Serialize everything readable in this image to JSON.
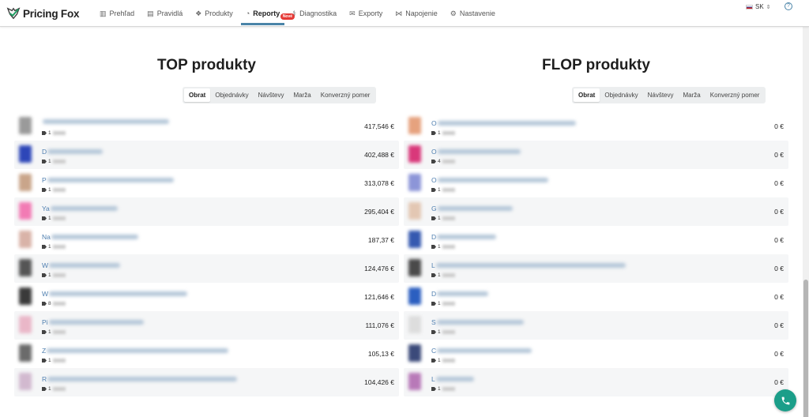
{
  "app": {
    "logo_text": "Pricing Fox"
  },
  "nav": [
    {
      "label": "Prehľad",
      "icon": "bar-chart-icon",
      "active": false
    },
    {
      "label": "Pravidlá",
      "icon": "list-icon",
      "active": false
    },
    {
      "label": "Produkty",
      "icon": "boxes-icon",
      "active": false
    },
    {
      "label": "Reporty",
      "icon": "pie-chart-icon",
      "active": true,
      "badge": "Nové"
    },
    {
      "label": "Diagnostika",
      "icon": "stethoscope-icon",
      "active": false
    },
    {
      "label": "Exporty",
      "icon": "inbox-icon",
      "active": false
    },
    {
      "label": "Napojenie",
      "icon": "share-icon",
      "active": false
    },
    {
      "label": "Nastavenie",
      "icon": "gear-icon",
      "active": false
    }
  ],
  "language": "SK",
  "help": "?",
  "accent_color": "#4a84a8",
  "top": {
    "title": "TOP produkty",
    "tabs": [
      "Obrat",
      "Objednávky",
      "Návštevy",
      "Marža",
      "Konverzný pomer"
    ],
    "active_tab": "Obrat",
    "rows": [
      {
        "name_start": "",
        "count": "1",
        "value": "417,546 €",
        "color": "#9a9a9a"
      },
      {
        "name_start": "D",
        "count": "1",
        "value": "402,488 €",
        "color": "#2d46b8"
      },
      {
        "name_start": "P",
        "count": "1",
        "value": "313,078 €",
        "color": "#c9a58a"
      },
      {
        "name_start": "Ya",
        "count": "1",
        "value": "295,404 €",
        "color": "#f27bb4"
      },
      {
        "name_start": "Na",
        "count": "1",
        "value": "187,37 €",
        "color": "#d9b3a8"
      },
      {
        "name_start": "W",
        "count": "1",
        "value": "124,476 €",
        "color": "#555555"
      },
      {
        "name_start": "W",
        "count": "8",
        "value": "121,646 €",
        "color": "#3a3a3a"
      },
      {
        "name_start": "Pi",
        "count": "1",
        "value": "111,076 €",
        "color": "#eab7c8"
      },
      {
        "name_start": "Z",
        "count": "1",
        "value": "105,13 €",
        "color": "#6b6b6b"
      },
      {
        "name_start": "R",
        "count": "1",
        "value": "104,426 €",
        "color": "#d2b9cf"
      }
    ]
  },
  "flop": {
    "title": "FLOP produkty",
    "tabs": [
      "Obrat",
      "Objednávky",
      "Návštevy",
      "Marža",
      "Konverzný pomer"
    ],
    "active_tab": "Obrat",
    "rows": [
      {
        "name_start": "O",
        "count": "1",
        "value": "0 €",
        "color": "#e6a27e"
      },
      {
        "name_start": "O",
        "count": "4",
        "value": "0 €",
        "color": "#d9387a"
      },
      {
        "name_start": "O",
        "count": "1",
        "value": "0 €",
        "color": "#8c95d8"
      },
      {
        "name_start": "G",
        "count": "1",
        "value": "0 €",
        "color": "#e3c7b3"
      },
      {
        "name_start": "D",
        "count": "1",
        "value": "0 €",
        "color": "#3559b0"
      },
      {
        "name_start": "L",
        "count": "1",
        "value": "0 €",
        "color": "#4a4a4a"
      },
      {
        "name_start": "D",
        "count": "1",
        "value": "0 €",
        "color": "#2b5fc0"
      },
      {
        "name_start": "S",
        "count": "1",
        "value": "0 €",
        "color": "#dddddd"
      },
      {
        "name_start": "C",
        "count": "1",
        "value": "0 €",
        "color": "#3b4a7a"
      },
      {
        "name_start": "L",
        "count": "1",
        "value": "0 €",
        "color": "#b879b8"
      }
    ]
  }
}
